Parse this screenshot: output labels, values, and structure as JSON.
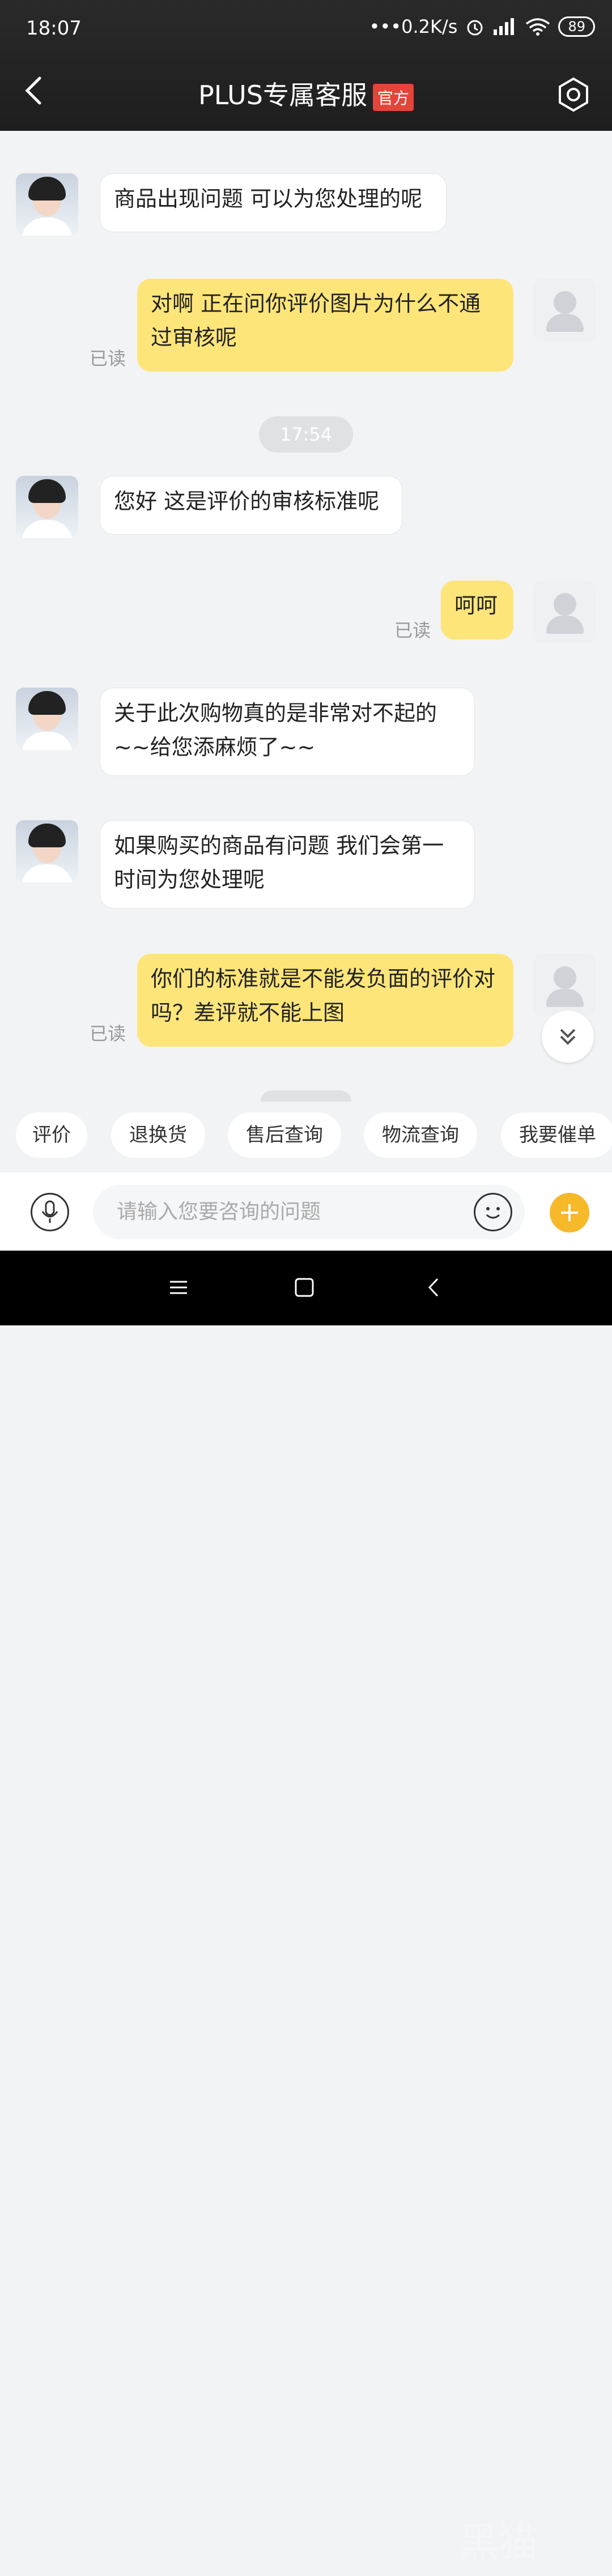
{
  "status": {
    "time": "18:07",
    "network_speed": "•••0.2K/s",
    "battery": "89",
    "icons": [
      "alarm-icon",
      "signal-icon",
      "wifi-icon",
      "battery-icon"
    ]
  },
  "header": {
    "title": "PLUS专属客服",
    "badge": "官方",
    "back_icon": "chevron-left-icon",
    "settings_icon": "hex-settings-icon",
    "badge_color": "#e5443a"
  },
  "chat": {
    "messages": [
      {
        "from": "agent",
        "text": "商品出现问题 可以为您处理的呢"
      },
      {
        "from": "user",
        "text": "对啊 正在问你评价图片为什么不通过审核呢",
        "read": "已读"
      },
      {
        "from": "time",
        "text": "17:54"
      },
      {
        "from": "agent",
        "text": "您好 这是评价的审核标准呢"
      },
      {
        "from": "user",
        "text": "呵呵",
        "read": "已读"
      },
      {
        "from": "agent",
        "text": "关于此次购物真的是非常对不起的~~给您添麻烦了~~"
      },
      {
        "from": "agent",
        "text": "如果购买的商品有问题 我们会第一时间为您处理呢"
      },
      {
        "from": "user",
        "text": "你们的标准就是不能发负面的评价对吗？差评就不能上图",
        "read": "已读"
      }
    ],
    "user_bubble_color": "#fde57a"
  },
  "quick": {
    "chips": [
      "评价",
      "退换货",
      "售后查询",
      "物流查询",
      "我要催单"
    ]
  },
  "input": {
    "placeholder": "请输入您要咨询的问题",
    "icons": [
      "microphone-icon",
      "emoji-icon",
      "plus-icon"
    ],
    "accent": "#f5b92a"
  },
  "watermark": "黑猫"
}
